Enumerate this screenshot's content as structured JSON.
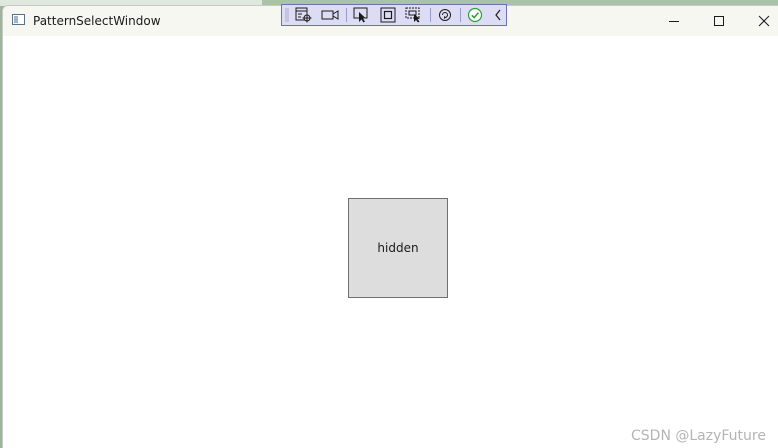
{
  "window": {
    "title": "PatternSelectWindow"
  },
  "toolbar": {
    "buttons": [
      {
        "icon": "select-element-icon"
      },
      {
        "icon": "record-camera-icon"
      },
      {
        "icon": "pointer-select-icon"
      },
      {
        "icon": "display-adorners-icon"
      },
      {
        "icon": "track-focus-icon"
      },
      {
        "icon": "hot-reload-icon"
      },
      {
        "icon": "checkmark-icon"
      },
      {
        "icon": "collapse-chevron-icon"
      }
    ],
    "colors": {
      "background": "#dcdcf4",
      "border": "#6f6fb4",
      "check": "#2e9e3a"
    }
  },
  "content": {
    "box_label": "hidden"
  },
  "watermark": {
    "text": "CSDN @LazyFuture"
  },
  "colors": {
    "titlebar": "#f6f7f1",
    "box_fill": "#dddddd",
    "box_border": "#707070"
  }
}
